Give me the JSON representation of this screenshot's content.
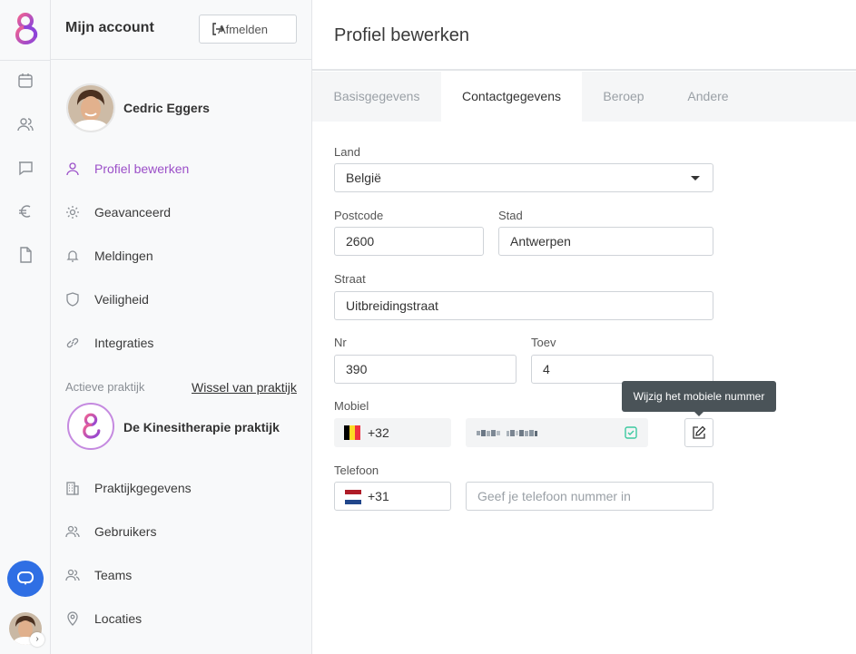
{
  "sidebar": {
    "title": "Mijn account",
    "logout_label": "Afmelden",
    "user_name": "Cedric Eggers",
    "account_nav": [
      {
        "label": "Profiel bewerken",
        "icon": "user-icon",
        "active": true
      },
      {
        "label": "Geavanceerd",
        "icon": "gear-icon",
        "active": false
      },
      {
        "label": "Meldingen",
        "icon": "bell-icon",
        "active": false
      },
      {
        "label": "Veiligheid",
        "icon": "shield-icon",
        "active": false
      },
      {
        "label": "Integraties",
        "icon": "link-icon",
        "active": false
      }
    ],
    "active_practice_label": "Actieve praktijk",
    "switch_practice_label": "Wissel van praktijk",
    "practice_name": "De Kinesitherapie praktijk",
    "practice_nav": [
      {
        "label": "Praktijkgegevens",
        "icon": "building-icon"
      },
      {
        "label": "Gebruikers",
        "icon": "users-icon"
      },
      {
        "label": "Teams",
        "icon": "team-icon"
      },
      {
        "label": "Locaties",
        "icon": "location-pin-icon"
      }
    ]
  },
  "rail": {
    "icons": [
      "calendar-icon",
      "users-icon",
      "chat-icon",
      "euro-icon",
      "document-icon"
    ],
    "accent": "#2f6fe4"
  },
  "main": {
    "title": "Profiel bewerken",
    "tabs": [
      {
        "label": "Basisgegevens",
        "active": false
      },
      {
        "label": "Contactgegevens",
        "active": true
      },
      {
        "label": "Beroep",
        "active": false
      },
      {
        "label": "Andere",
        "active": false
      }
    ],
    "form": {
      "land_label": "Land",
      "land_value": "België",
      "postcode_label": "Postcode",
      "postcode_value": "2600",
      "stad_label": "Stad",
      "stad_value": "Antwerpen",
      "straat_label": "Straat",
      "straat_value": "Uitbreidingstraat",
      "nr_label": "Nr",
      "nr_value": "390",
      "toev_label": "Toev",
      "toev_value": "4",
      "mobiel_label": "Mobiel",
      "mobiel_prefix": "+32",
      "mobiel_tooltip": "Wijzig het mobiele nummer",
      "telefoon_label": "Telefoon",
      "telefoon_prefix": "+31",
      "telefoon_placeholder": "Geef je telefoon nummer in"
    }
  },
  "colors": {
    "brand_purple": "#9b4fc8",
    "success_green": "#3cc9a0",
    "tooltip_bg": "#4a5358"
  }
}
